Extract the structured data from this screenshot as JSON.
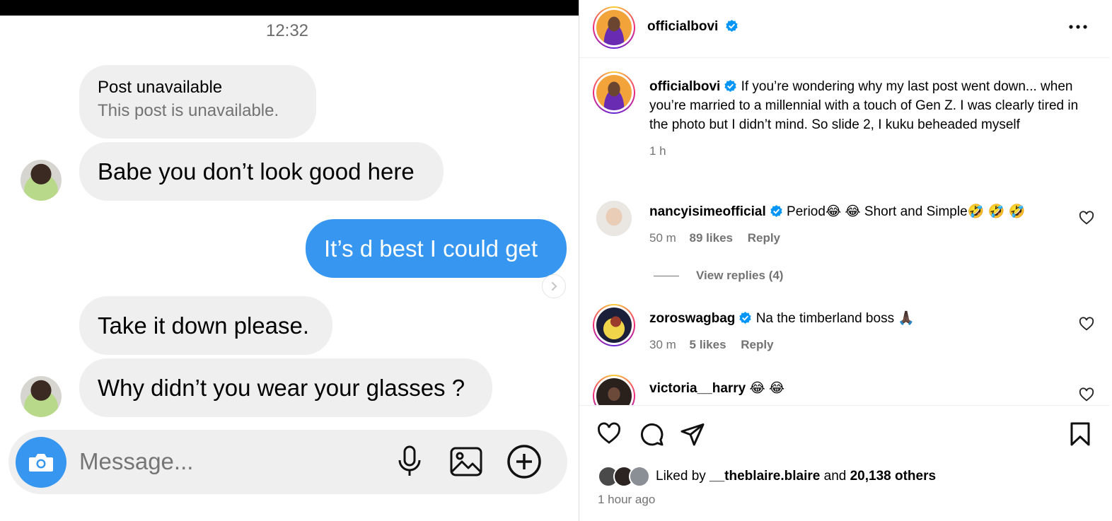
{
  "chat": {
    "time": "12:32",
    "shared_post": {
      "title": "Post unavailable",
      "subtitle": "This post is unavailable."
    },
    "messages": [
      {
        "text": "Babe you don’t look good here",
        "from": "them"
      },
      {
        "text": "It’s d best I could get",
        "from": "me"
      },
      {
        "text": "Take it down please.",
        "from": "them"
      },
      {
        "text": "Why didn’t you wear your glasses ?",
        "from": "them"
      }
    ],
    "composer": {
      "placeholder": "Message..."
    },
    "colors": {
      "sent_bubble": "#3797f0",
      "received_bubble": "#efefef"
    },
    "icons": [
      "camera-icon",
      "microphone-icon",
      "image-icon",
      "plus-circle-icon",
      "chevron-right-icon"
    ]
  },
  "post": {
    "author": "officialbovi",
    "caption_user": "officialbovi",
    "caption_text": "If you’re wondering why my last post went down... when you’re married to a millennial with a touch of Gen Z. I was clearly tired in the photo but I didn’t mind. So slide 2, I kuku beheaded myself",
    "caption_time": "1 h",
    "comments": [
      {
        "user": "nancyisimeofficial",
        "text": "Period😂 😂  Short and Simple🤣 🤣 🤣",
        "time": "50 m",
        "likes": "89 likes",
        "reply": "Reply",
        "view_replies": "View replies (4)"
      },
      {
        "user": "zoroswagbag",
        "text": "Na the timberland boss 🙏🏿",
        "time": "30 m",
        "likes": "5 likes",
        "reply": "Reply"
      },
      {
        "user": "victoria__harry",
        "text": "😂 😂"
      }
    ],
    "liked_by_prefix": "Liked by ",
    "liked_by_user": "__theblaire.blaire",
    "liked_by_and": " and ",
    "liked_by_count": "20,138 others",
    "posted_ago": "1 hour ago",
    "colors": {
      "verified": "#0095f6",
      "story_ring": "#ee2a7b"
    },
    "icons": [
      "verified-badge-icon",
      "more-options-icon",
      "heart-icon",
      "comment-icon",
      "share-icon",
      "bookmark-icon"
    ]
  }
}
